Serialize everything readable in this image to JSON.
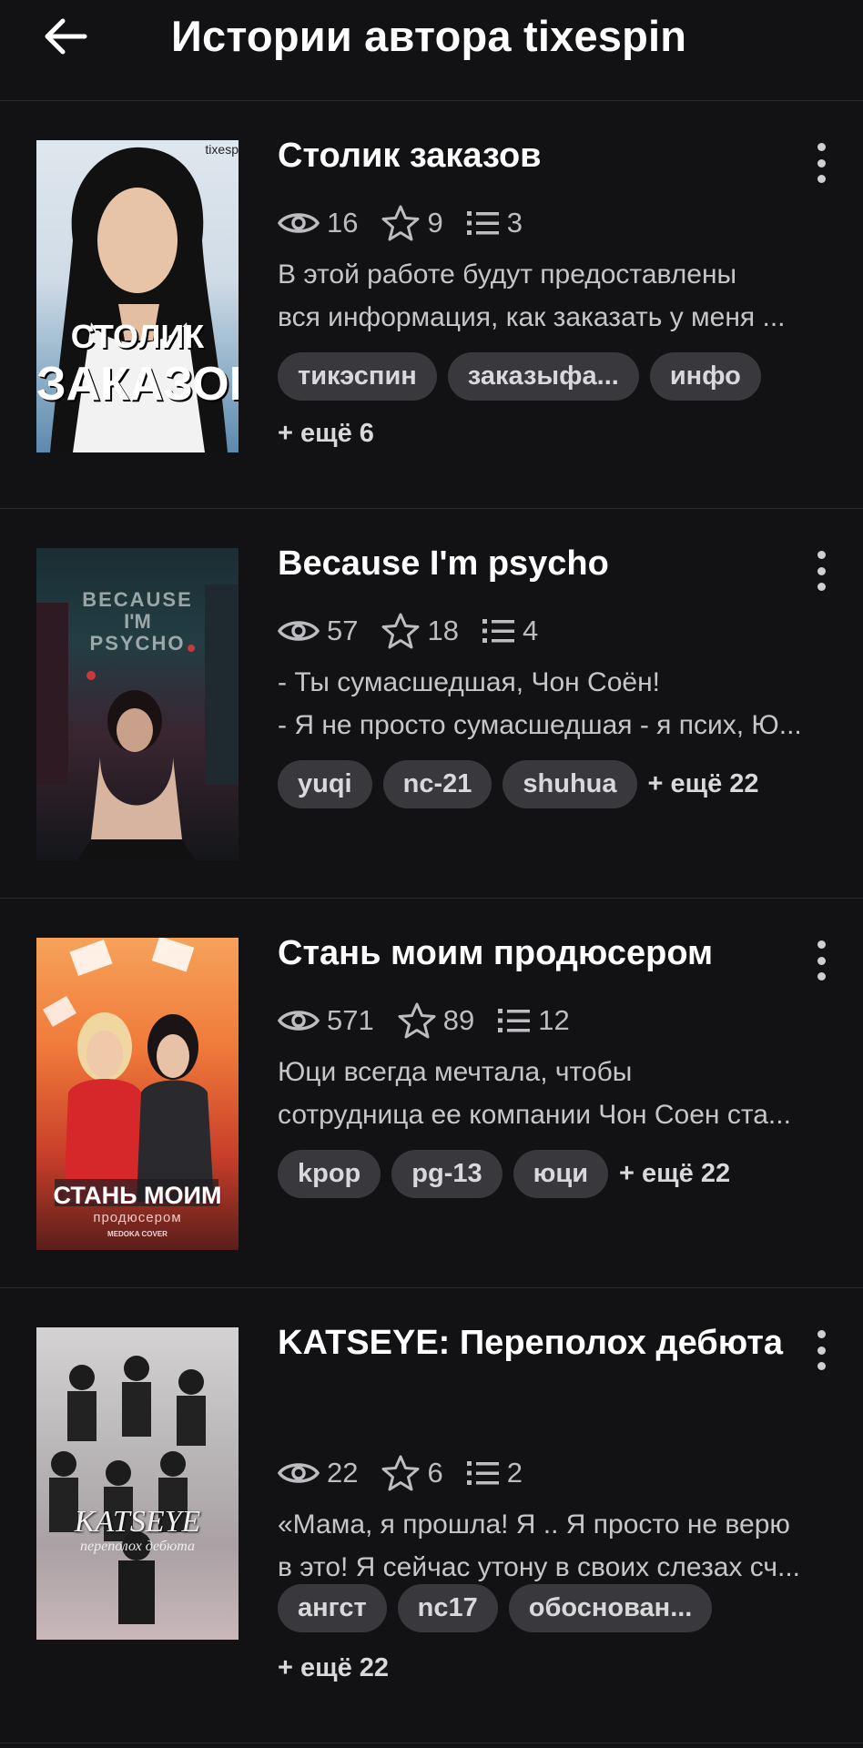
{
  "header": {
    "title": "Истории автора tixespin",
    "back_icon": "arrow-left-icon"
  },
  "colors": {
    "background": "#121113",
    "chip": "#39383c",
    "muted_text": "#bdbdc1"
  },
  "stories": [
    {
      "title": "Столик заказов",
      "views": "16",
      "votes": "9",
      "parts": "3",
      "desc": [
        "В этой работе будут предоставлены",
        "вся информация, как заказать у меня ..."
      ],
      "tags": [
        "тикэспин",
        "заказыфа...",
        "инфо"
      ],
      "more_tags": "+ ещё 6",
      "cover_text": [
        "СТОЛИК",
        "ЗАКАЗОВ"
      ],
      "cover_watermark": "tixesp"
    },
    {
      "title": "Because I'm psycho",
      "views": "57",
      "votes": "18",
      "parts": "4",
      "desc": [
        "- Ты сумасшедшая, Чон Соён!",
        "- Я не просто сумасшедшая - я псих, Ю..."
      ],
      "tags": [
        "yuqi",
        "nc-21",
        "shuhua"
      ],
      "more_tags": "+ ещё 22",
      "cover_text": [
        "BECAUSE",
        "I'M",
        "PSYCHO"
      ]
    },
    {
      "title": "Стань моим продюсером",
      "views": "571",
      "votes": "89",
      "parts": "12",
      "desc": [
        "Юци всегда мечтала, чтобы",
        "сотрудница ее компании Чон Соен ста..."
      ],
      "tags": [
        "kpop",
        "pg-13",
        "юци"
      ],
      "more_tags": "+ ещё 22",
      "cover_text": [
        "СТАНЬ МОИМ",
        "продюсером",
        "МЕDOKA COVER"
      ]
    },
    {
      "title": "KATSEYE: Переполох дебюта",
      "views": "22",
      "votes": "6",
      "parts": "2",
      "desc": [
        "«Мама, я прошла! Я .. Я просто не верю",
        "в это! Я сейчас утону в своих слезах сч..."
      ],
      "tags": [
        "ангст",
        "nc17",
        "обоснован..."
      ],
      "more_tags": "+ ещё 22",
      "cover_text": [
        "KATSEYE",
        "переполох дебюта"
      ]
    }
  ]
}
